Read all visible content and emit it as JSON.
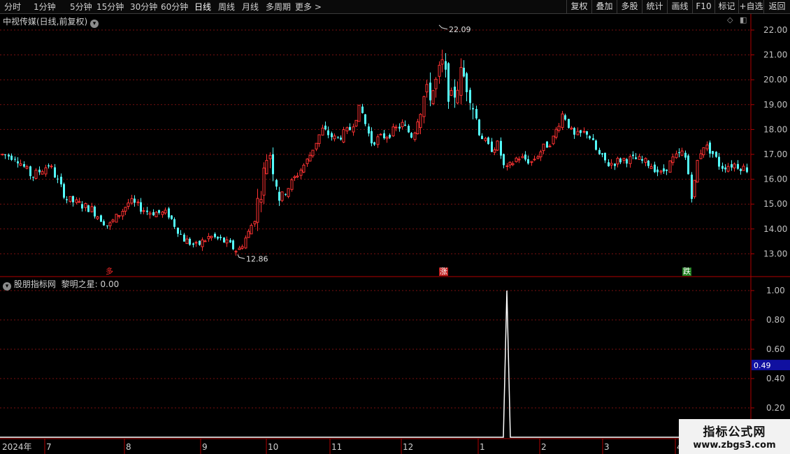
{
  "toolbar": {
    "periods": [
      "分时",
      "1分钟",
      "5分钟",
      "15分钟",
      "30分钟",
      "60分钟",
      "日线",
      "周线",
      "月线",
      "多周期",
      "更多 >"
    ],
    "active_period": "日线",
    "actions": [
      "复权",
      "叠加",
      "多股",
      "统计",
      "画线",
      "F10",
      "标记",
      "+自选",
      "返回"
    ]
  },
  "main_panel": {
    "legend": "中视传媒(日线,前复权)",
    "price_ticks": [
      "22.00",
      "21.00",
      "20.00",
      "19.00",
      "18.00",
      "17.00",
      "16.00",
      "15.00",
      "14.00",
      "13.00"
    ],
    "high_label": "22.09",
    "low_label": "12.86",
    "signals": [
      {
        "text": "多",
        "color": "#ff2a2a",
        "bg": "#000000"
      },
      {
        "text": "涨",
        "color": "#ffffff",
        "bg": "#c02020"
      },
      {
        "text": "跌",
        "color": "#ffffff",
        "bg": "#208020"
      }
    ],
    "colors": {
      "up": "#ff3232",
      "down": "#54fcfc",
      "grid": "#7a1010",
      "axis": "#b00000"
    }
  },
  "indicator_panel": {
    "legend_source": "股朋指标网",
    "legend_name": "黎明之星:",
    "legend_value": "0.00",
    "ticks": [
      "1.00",
      "0.80",
      "0.60",
      "0.40",
      "0.20"
    ],
    "current_value": "0.49"
  },
  "date_axis": {
    "year_label": "2024年",
    "months": [
      "7",
      "8",
      "9",
      "10",
      "11",
      "12",
      "1",
      "2",
      "3",
      "4"
    ]
  },
  "chart_data": {
    "type": "candlestick",
    "title": "中视传媒(日线,前复权)",
    "ylim": [
      12.6,
      22.4
    ],
    "max_high": 22.09,
    "min_low": 12.86,
    "series": [
      {
        "name": "close",
        "dates_span": "2024-06 to 2025-04",
        "monthly_close_estimates": [
          {
            "month": "2024-06",
            "value": 16.9
          },
          {
            "month": "2024-07",
            "value": 14.8
          },
          {
            "month": "2024-08",
            "value": 14.6
          },
          {
            "month": "2024-09",
            "value": 13.6
          },
          {
            "month": "2024-10",
            "value": 15.5
          },
          {
            "month": "2024-11",
            "value": 18.3
          },
          {
            "month": "2024-12",
            "value": 19.3
          },
          {
            "month": "2025-01",
            "value": 16.8
          },
          {
            "month": "2025-02",
            "value": 17.6
          },
          {
            "month": "2025-03",
            "value": 16.6
          },
          {
            "month": "2025-04",
            "value": 16.5
          }
        ]
      },
      {
        "name": "黎明之星",
        "spike_month": "2025-01",
        "spike_value": 1.0,
        "baseline": 0.0
      }
    ]
  }
}
